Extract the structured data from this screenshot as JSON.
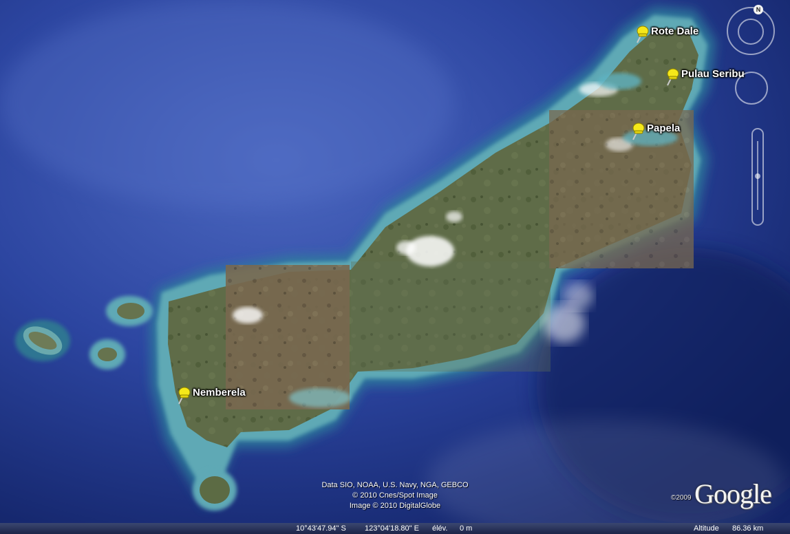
{
  "map": {
    "placemarks": [
      {
        "name": "Rote Dale"
      },
      {
        "name": "Pulau Seribu"
      },
      {
        "name": "Papela"
      },
      {
        "name": "Nemberela"
      }
    ],
    "attribution": [
      "Data SIO, NOAA, U.S. Navy, NGA, GEBCO",
      "© 2010 Cnes/Spot Image",
      "Image © 2010 DigitalGlobe"
    ],
    "logo": {
      "copyright": "©2009",
      "word": "Google"
    },
    "compass": {
      "north_label": "N"
    }
  },
  "status_bar": {
    "latitude": "10°43'47.94\" S",
    "longitude": "123°04'18.80\" E",
    "elevation_label": "élév.",
    "elevation_value": "0 m",
    "altitude_label": "Altitude",
    "altitude_value": "86.36 km"
  },
  "colors": {
    "ocean_deep": "#1b2f80",
    "ocean_light": "#3d5bb0",
    "reef": "#6fb5c0",
    "land_green": "#5d6b45",
    "land_brown": "#7a6a52",
    "pin": "#f5e81a"
  }
}
